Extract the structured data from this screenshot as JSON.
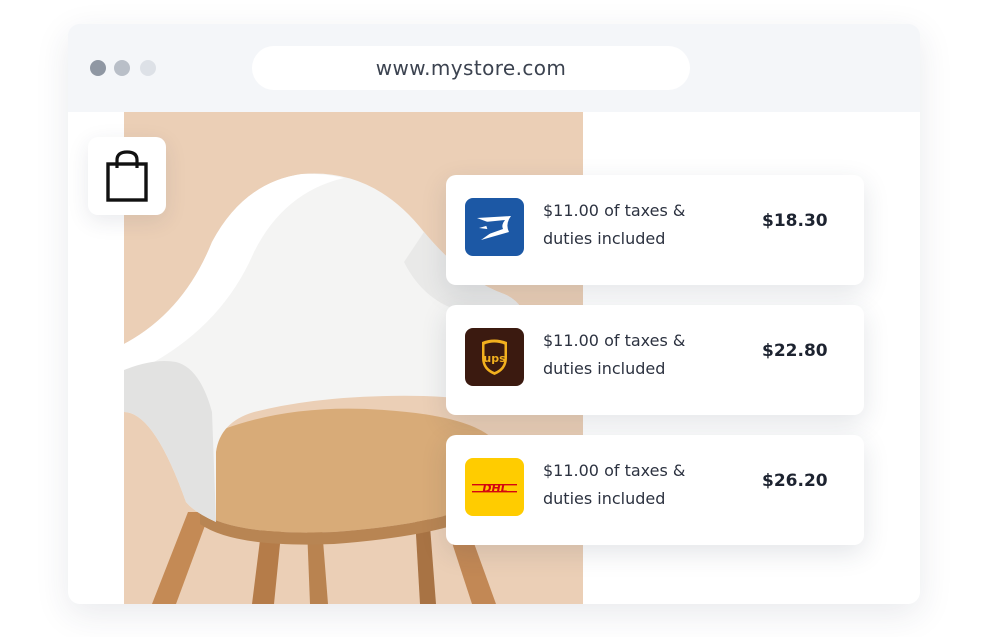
{
  "browser": {
    "url": "www.mystore.com"
  },
  "icons": {
    "shopping_bag": "shopping-bag-icon",
    "usps": "usps-eagle-logo",
    "ups": "ups-shield-logo",
    "dhl": "dhl-logo"
  },
  "colors": {
    "usps_blue": "#1c58a5",
    "ups_brown": "#3b1a10",
    "dhl_yellow": "#ffcc00",
    "dhl_red": "#d40511",
    "image_background": "#ebcfb6"
  },
  "shipping_options": [
    {
      "carrier_logo": "usps",
      "description_line1": "$11.00 of taxes &",
      "description_line2": "duties included",
      "price": "$18.30"
    },
    {
      "carrier_logo": "ups",
      "logo_text": "ups",
      "description_line1": "$11.00 of taxes &",
      "description_line2": "duties included",
      "price": "$22.80"
    },
    {
      "carrier_logo": "dhl",
      "logo_text": "DHL",
      "description_line1": "$11.00 of taxes &",
      "description_line2": "duties included",
      "price": "$26.20"
    }
  ]
}
